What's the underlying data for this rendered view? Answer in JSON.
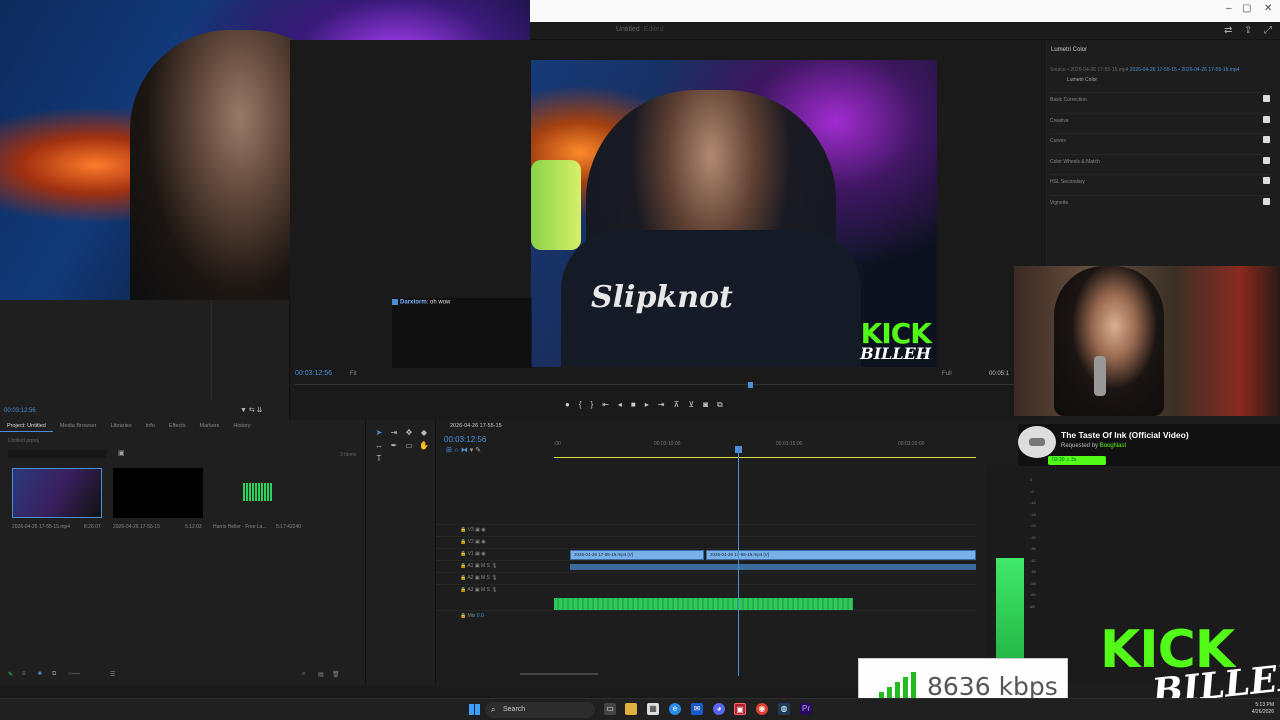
{
  "window": {
    "title": "Untitled",
    "status": "Edited",
    "ctl_min": "–",
    "ctl_max": "▢",
    "ctl_close": "✕"
  },
  "chat": {
    "user": "Darxtorm",
    "message": ": oh wow"
  },
  "overlay": {
    "kick": "KICK",
    "billeh": "BILLEH"
  },
  "program": {
    "timecode": "00:03:12:56",
    "fit": "Fit",
    "quality": "Full",
    "right_tc": "00:05:1",
    "shirt": "Slipknot"
  },
  "source": {
    "timecode": "00:03:12:56"
  },
  "lumetri": {
    "tab": "Lumetri Color",
    "source_label": "Source • 2026-04-26 17-55-15.mp4",
    "source_link": "2026-04-26 17-55-15 • 2026-04-26 17-55-15.mp4",
    "sub_label": "Lumetri Color",
    "sections": [
      "Basic Correction",
      "Creative",
      "Curves",
      "Color Wheels & Match",
      "HSL Secondary",
      "Vignette"
    ]
  },
  "music": {
    "title": "The Taste Of Ink (Official Video)",
    "requested_prefix": "Requested by",
    "requested_by": "BoogNast",
    "pill": "03:20 ♫ 3s"
  },
  "project": {
    "tabs": [
      "Project: Untitled",
      "Media Browser",
      "Libraries",
      "Info",
      "Effects",
      "Markers",
      "History"
    ],
    "file": "Untitled.prproj",
    "items_count": "3 Items",
    "items": [
      {
        "name": "2026-04-26 17-55-15.mp4",
        "duration": "8:26:07"
      },
      {
        "name": "2026-04-26 17-55-15",
        "duration": "5:12:03"
      },
      {
        "name": "Harris Heller - Free La...",
        "duration": "5:17:42240"
      }
    ]
  },
  "timeline": {
    "tab": "2026-04-26 17-55-15",
    "timecode": "00:03:12:56",
    "ruler": [
      ":00",
      "00:03:10:00",
      "00:03:15:00",
      "00:03:20:00"
    ],
    "tracks": [
      "V3",
      "V2",
      "V1",
      "A1",
      "A2",
      "A3",
      "Mix"
    ],
    "clip1": "2026-04-26 17-55-15.mp4 [V]",
    "clip2": "2026-04-26 17-55-15.mp4 [V]",
    "mix_val": "0.0"
  },
  "meters": {
    "scale": [
      "0",
      "-6",
      "-12",
      "-18",
      "-24",
      "-30",
      "-36",
      "-42",
      "-48",
      "-54",
      "-60",
      "dB"
    ]
  },
  "bitrate": {
    "value": "8636 kbps"
  },
  "taskbar": {
    "search": "Search",
    "time": "5:13 PM",
    "date": "4/26/2026"
  },
  "colors": {
    "accent": "#4a8fd6",
    "kick_green": "#53fc18"
  }
}
